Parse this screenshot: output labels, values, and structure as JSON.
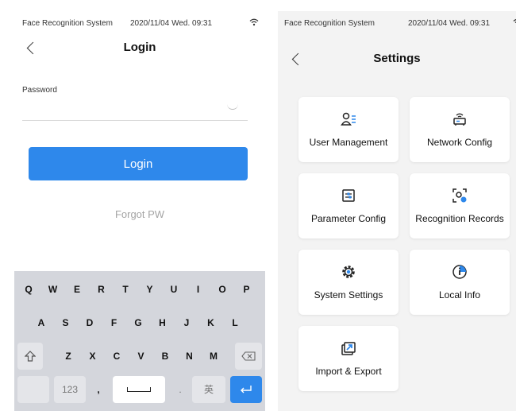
{
  "login_screen": {
    "status": {
      "app_name": "Face Recognition System",
      "datetime": "2020/11/04  Wed.  09:31"
    },
    "title": "Login",
    "password_label": "Password",
    "login_button": "Login",
    "forgot_link": "Forgot PW",
    "keyboard": {
      "row1": [
        "Q",
        "W",
        "E",
        "R",
        "T",
        "Y",
        "U",
        "I",
        "O",
        "P"
      ],
      "row2": [
        "A",
        "S",
        "D",
        "F",
        "G",
        "H",
        "J",
        "K",
        "L"
      ],
      "row3": [
        "Z",
        "X",
        "C",
        "V",
        "B",
        "N",
        "M"
      ],
      "numbers_key": "123",
      "comma_key": ",",
      "period_key": ".",
      "lang_key": "英",
      "shift_icon": "shift-icon",
      "backspace_icon": "backspace-icon",
      "enter_icon": "enter-icon"
    }
  },
  "settings_screen": {
    "status": {
      "app_name": "Face Recognition System",
      "datetime": "2020/11/04  Wed.  09:31"
    },
    "title": "Settings",
    "tiles": [
      {
        "label": "User Management",
        "icon": "users-icon"
      },
      {
        "label": "Network Config",
        "icon": "router-icon"
      },
      {
        "label": "Parameter Config",
        "icon": "sliders-icon"
      },
      {
        "label": "Recognition Records",
        "icon": "face-scan-icon"
      },
      {
        "label": "System Settings",
        "icon": "gear-icon"
      },
      {
        "label": "Local Info",
        "icon": "info-icon"
      },
      {
        "label": "Import & Export",
        "icon": "import-export-icon"
      }
    ]
  },
  "colors": {
    "accent": "#2e88eb",
    "link_gray": "#a4a4a4",
    "settings_bg": "#f3f3f3",
    "keyboard_bg": "#d4d6dc"
  }
}
